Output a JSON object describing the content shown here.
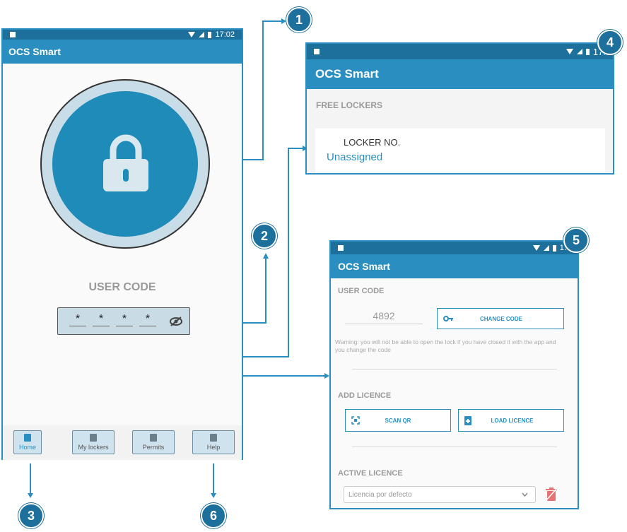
{
  "badges": [
    "1",
    "2",
    "3",
    "4",
    "5",
    "6"
  ],
  "left_phone": {
    "status_time": "17:02",
    "app_title": "OCS Smart",
    "user_code_label": "USER CODE",
    "code_digits": [
      "*",
      "*",
      "*",
      "*"
    ],
    "lock_icon": "lock-icon",
    "visibility_icon": "eye-off-icon",
    "nav": [
      {
        "label": "Home",
        "icon": "home-icon",
        "active": true
      },
      {
        "label": "My lockers",
        "icon": "locker-icon",
        "active": false
      },
      {
        "label": "Permits",
        "icon": "document-icon",
        "active": false
      },
      {
        "label": "Help",
        "icon": "help-icon",
        "active": false
      }
    ]
  },
  "lockers_screen": {
    "status_time": "17:",
    "app_title": "OCS Smart",
    "section_title": "FREE LOCKERS",
    "locker_label": "LOCKER NO.",
    "locker_value": "Unassigned"
  },
  "settings_screen": {
    "status_time": "17:",
    "app_title": "OCS Smart",
    "user_code_title": "USER CODE",
    "code_value": "4892",
    "change_code_label": "CHANGE CODE",
    "warning": "Warning: you will not be able to open the lock if you have closed it with the app and you change the code",
    "add_licence_title": "ADD LICENCE",
    "scan_qr_label": "SCAN QR",
    "load_licence_label": "LOAD LICENCE",
    "active_licence_title": "ACTIVE LICENCE",
    "licence_placeholder": "Licencia por defecto"
  },
  "colors": {
    "accent": "#2a8fc0",
    "dark": "#1d6f9c",
    "delete": "#e57373"
  }
}
